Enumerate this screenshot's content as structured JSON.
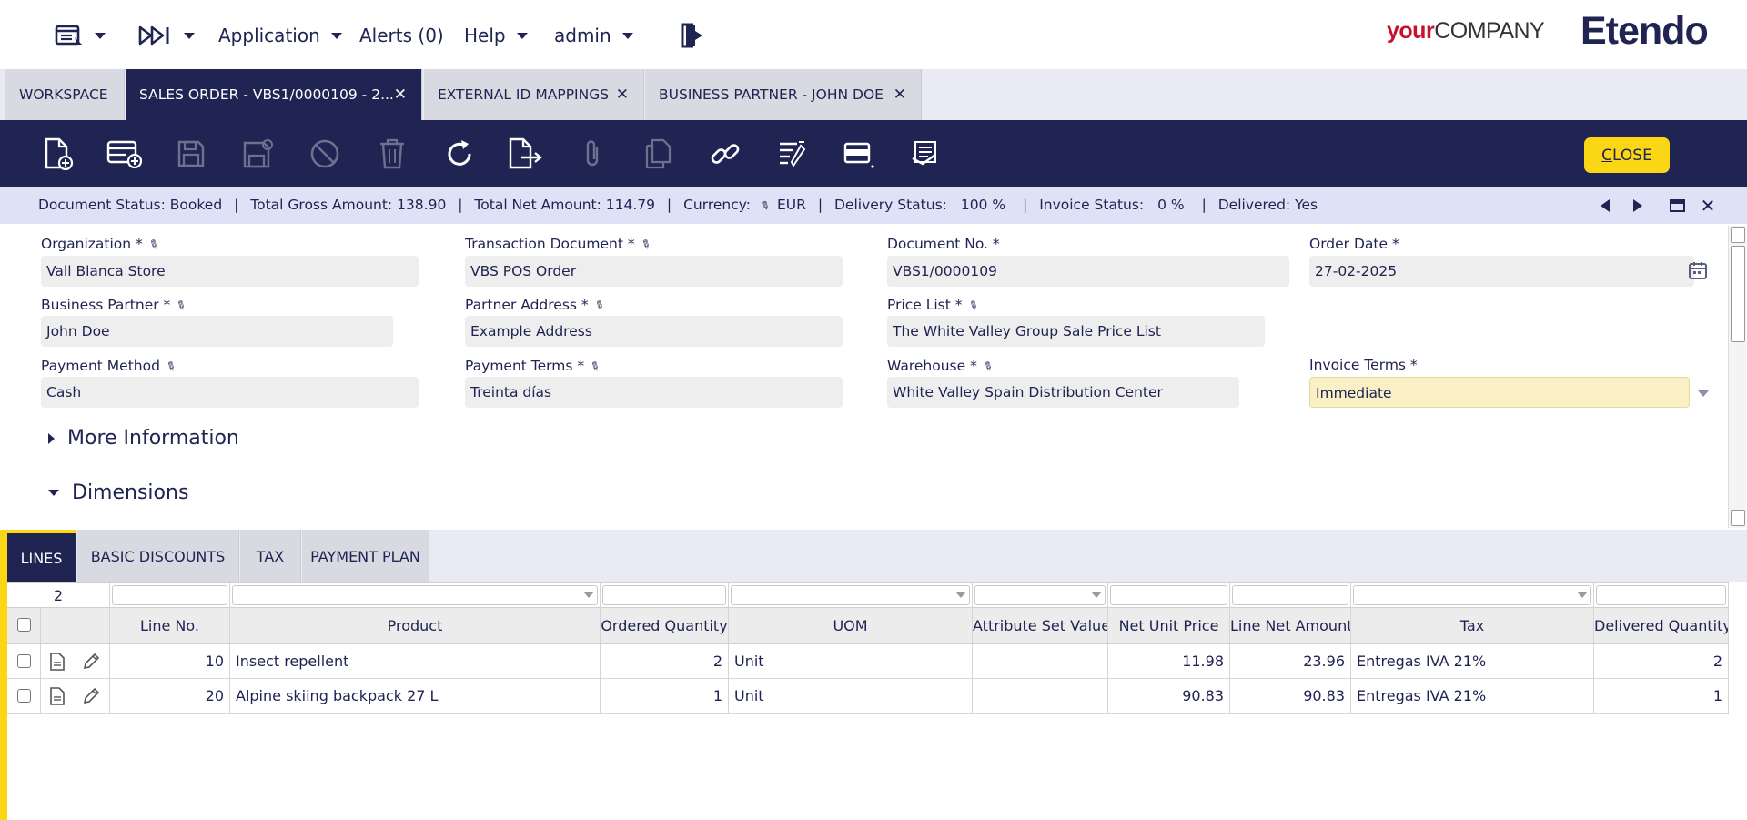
{
  "topnav": {
    "application_label": "Application",
    "alerts_label": "Alerts (0)",
    "help_label": "Help",
    "user_label": "admin",
    "brand_your": "your",
    "brand_company": "COMPANY",
    "brand_etendo": "Etendo"
  },
  "tabs": [
    {
      "label": "WORKSPACE",
      "closable": false
    },
    {
      "label": "SALES ORDER - VBS1/0000109 - 2...",
      "closable": true,
      "active": true
    },
    {
      "label": "EXTERNAL ID MAPPINGS",
      "closable": true
    },
    {
      "label": "BUSINESS PARTNER - JOHN DOE",
      "closable": true
    }
  ],
  "toolbar": {
    "icons": [
      "new-document-icon",
      "new-row-icon",
      "save-icon",
      "save-close-icon",
      "undo-icon",
      "delete-icon",
      "refresh-icon",
      "export-icon",
      "attachment-icon",
      "copy-record-icon",
      "link-icon",
      "process-icon",
      "grid-toggle-icon",
      "audit-icon"
    ],
    "close_label_first": "C",
    "close_label_rest": "LOSE"
  },
  "status": {
    "document_status": "Document Status: Booked",
    "sep": "|",
    "total_gross": "Total Gross Amount: 138.90",
    "total_net": "Total Net Amount: 114.79",
    "currency_label": "Currency:",
    "currency_value": "EUR",
    "delivery_label": "Delivery Status:",
    "delivery_value": "100 %",
    "invoice_label": "Invoice Status:",
    "invoice_value": "0 %",
    "delivered": "Delivered: Yes"
  },
  "form": {
    "organization": {
      "label": "Organization *",
      "value": "Vall Blanca Store"
    },
    "transaction_document": {
      "label": "Transaction Document *",
      "value": "VBS POS Order"
    },
    "document_no": {
      "label": "Document No. *",
      "value": "VBS1/0000109"
    },
    "order_date": {
      "label": "Order Date *",
      "value": "27-02-2025"
    },
    "business_partner": {
      "label": "Business Partner *",
      "value": "John Doe"
    },
    "partner_address": {
      "label": "Partner Address *",
      "value": "Example Address"
    },
    "price_list": {
      "label": "Price List *",
      "value": "The White Valley Group Sale Price List"
    },
    "payment_method": {
      "label": "Payment Method",
      "value": "Cash"
    },
    "payment_terms": {
      "label": "Payment Terms *",
      "value": "Treinta días"
    },
    "warehouse": {
      "label": "Warehouse *",
      "value": "White Valley Spain Distribution Center"
    },
    "invoice_terms": {
      "label": "Invoice Terms *",
      "value": "Immediate"
    },
    "more_information": "More Information",
    "dimensions": "Dimensions"
  },
  "subtabs": [
    "LINES",
    "BASIC DISCOUNTS",
    "TAX",
    "PAYMENT PLAN"
  ],
  "grid": {
    "record_count": "2",
    "columns": [
      "Line No.",
      "Product",
      "Ordered Quantity",
      "UOM",
      "Attribute Set Value",
      "Net Unit Price",
      "Line Net Amount",
      "Tax",
      "Delivered Quantity"
    ],
    "rows": [
      {
        "line_no": "10",
        "product": "Insect repellent",
        "ordered_qty": "2",
        "uom": "Unit",
        "attribute_set": "",
        "net_unit_price": "11.98",
        "line_net_amount": "23.96",
        "tax": "Entregas IVA 21%",
        "delivered_qty": "2"
      },
      {
        "line_no": "20",
        "product": "Alpine skiing backpack 27 L",
        "ordered_qty": "1",
        "uom": "Unit",
        "attribute_set": "",
        "net_unit_price": "90.83",
        "line_net_amount": "90.83",
        "tax": "Entregas IVA 21%",
        "delivered_qty": "1"
      }
    ]
  }
}
